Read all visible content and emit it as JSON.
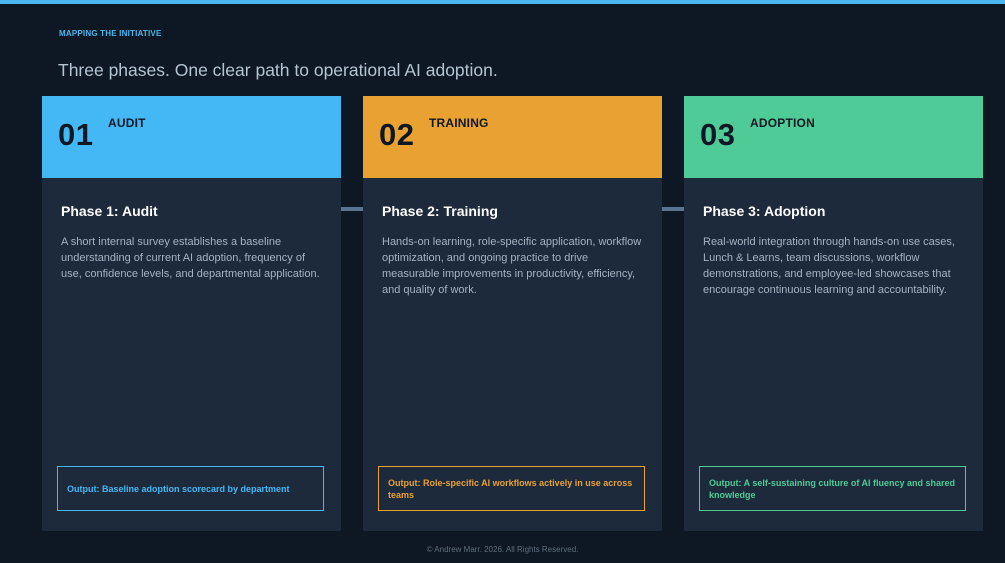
{
  "eyebrow": "MAPPING THE INITIATIVE",
  "headline": "Three phases. One clear path to operational AI adoption.",
  "phases": [
    {
      "number": "01",
      "tag": "AUDIT",
      "title": "Phase 1: Audit",
      "body": "A short internal survey establishes a baseline understanding of current AI adoption, frequency of use, confidence levels, and departmental application.",
      "output": "Output: Baseline adoption scorecard by department",
      "accent": "#44b8f5"
    },
    {
      "number": "02",
      "tag": "TRAINING",
      "title": "Phase 2: Training",
      "body": "Hands-on learning, role-specific application, workflow optimization, and ongoing practice to drive measurable improvements in productivity, efficiency, and quality of work.",
      "output": "Output: Role-specific AI workflows actively in use across teams",
      "accent": "#e9a232"
    },
    {
      "number": "03",
      "tag": "ADOPTION",
      "title": "Phase 3: Adoption",
      "body": "Real-world integration through hands-on use cases, Lunch & Learns, team discussions, workflow demonstrations, and employee-led showcases that encourage continuous learning and accountability.",
      "output": "Output: A self-sustaining culture of AI fluency and shared knowledge",
      "accent": "#4ecb96"
    }
  ],
  "footer": "© Andrew Marr. 2026. All Rights Reserved.",
  "colors": {
    "background": "#0e1824",
    "card": "#1c2a3b",
    "accent_top_bar": "#4ab8ef"
  }
}
